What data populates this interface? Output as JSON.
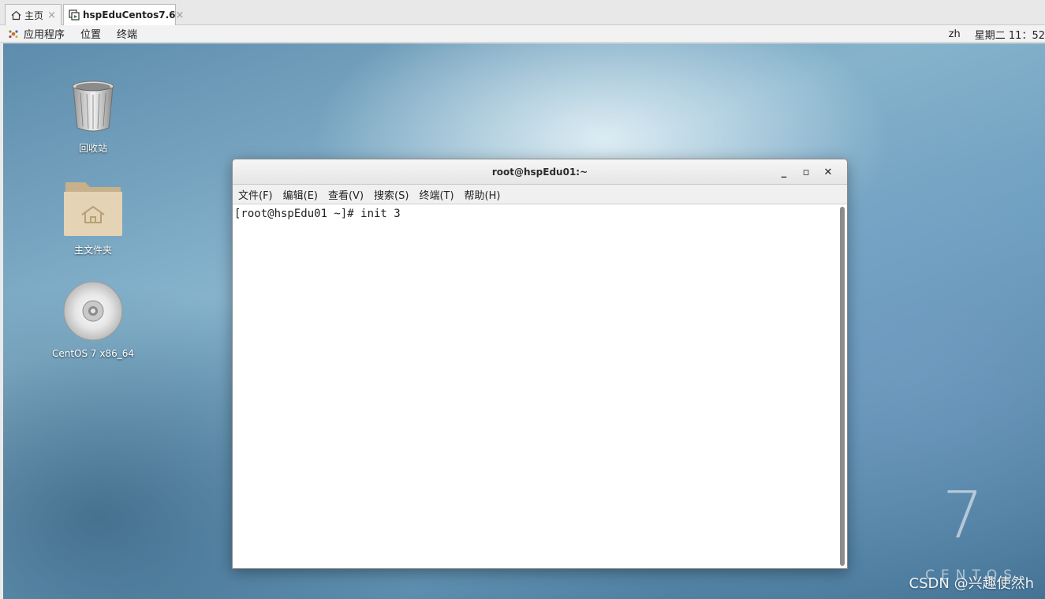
{
  "host_tabs": [
    {
      "label": "主页",
      "icon": "home-icon"
    },
    {
      "label": "hspEduCentos7.6",
      "icon": "vm-icon"
    }
  ],
  "panel": {
    "applications": "应用程序",
    "places": "位置",
    "terminal": "终端",
    "input_method": "zh",
    "clock": "星期二 11：52"
  },
  "desktop": {
    "icons": [
      {
        "label": "回收站",
        "icon": "trash-icon"
      },
      {
        "label": "主文件夹",
        "icon": "home-folder-icon"
      },
      {
        "label": "CentOS 7 x86_64",
        "icon": "disc-icon"
      }
    ],
    "brand_number": "7",
    "brand_word": "CENTOS",
    "watermark": "CSDN @兴趣使然h"
  },
  "terminal": {
    "title": "root@hspEdu01:~",
    "menu": [
      "文件(F)",
      "编辑(E)",
      "查看(V)",
      "搜索(S)",
      "终端(T)",
      "帮助(H)"
    ],
    "prompt_line": "[root@hspEdu01 ~]# init 3"
  },
  "colors": {
    "panel_bg": "#f2f2f2",
    "desktop_accent": "#6d9fbf",
    "terminal_bg": "#ffffff"
  }
}
